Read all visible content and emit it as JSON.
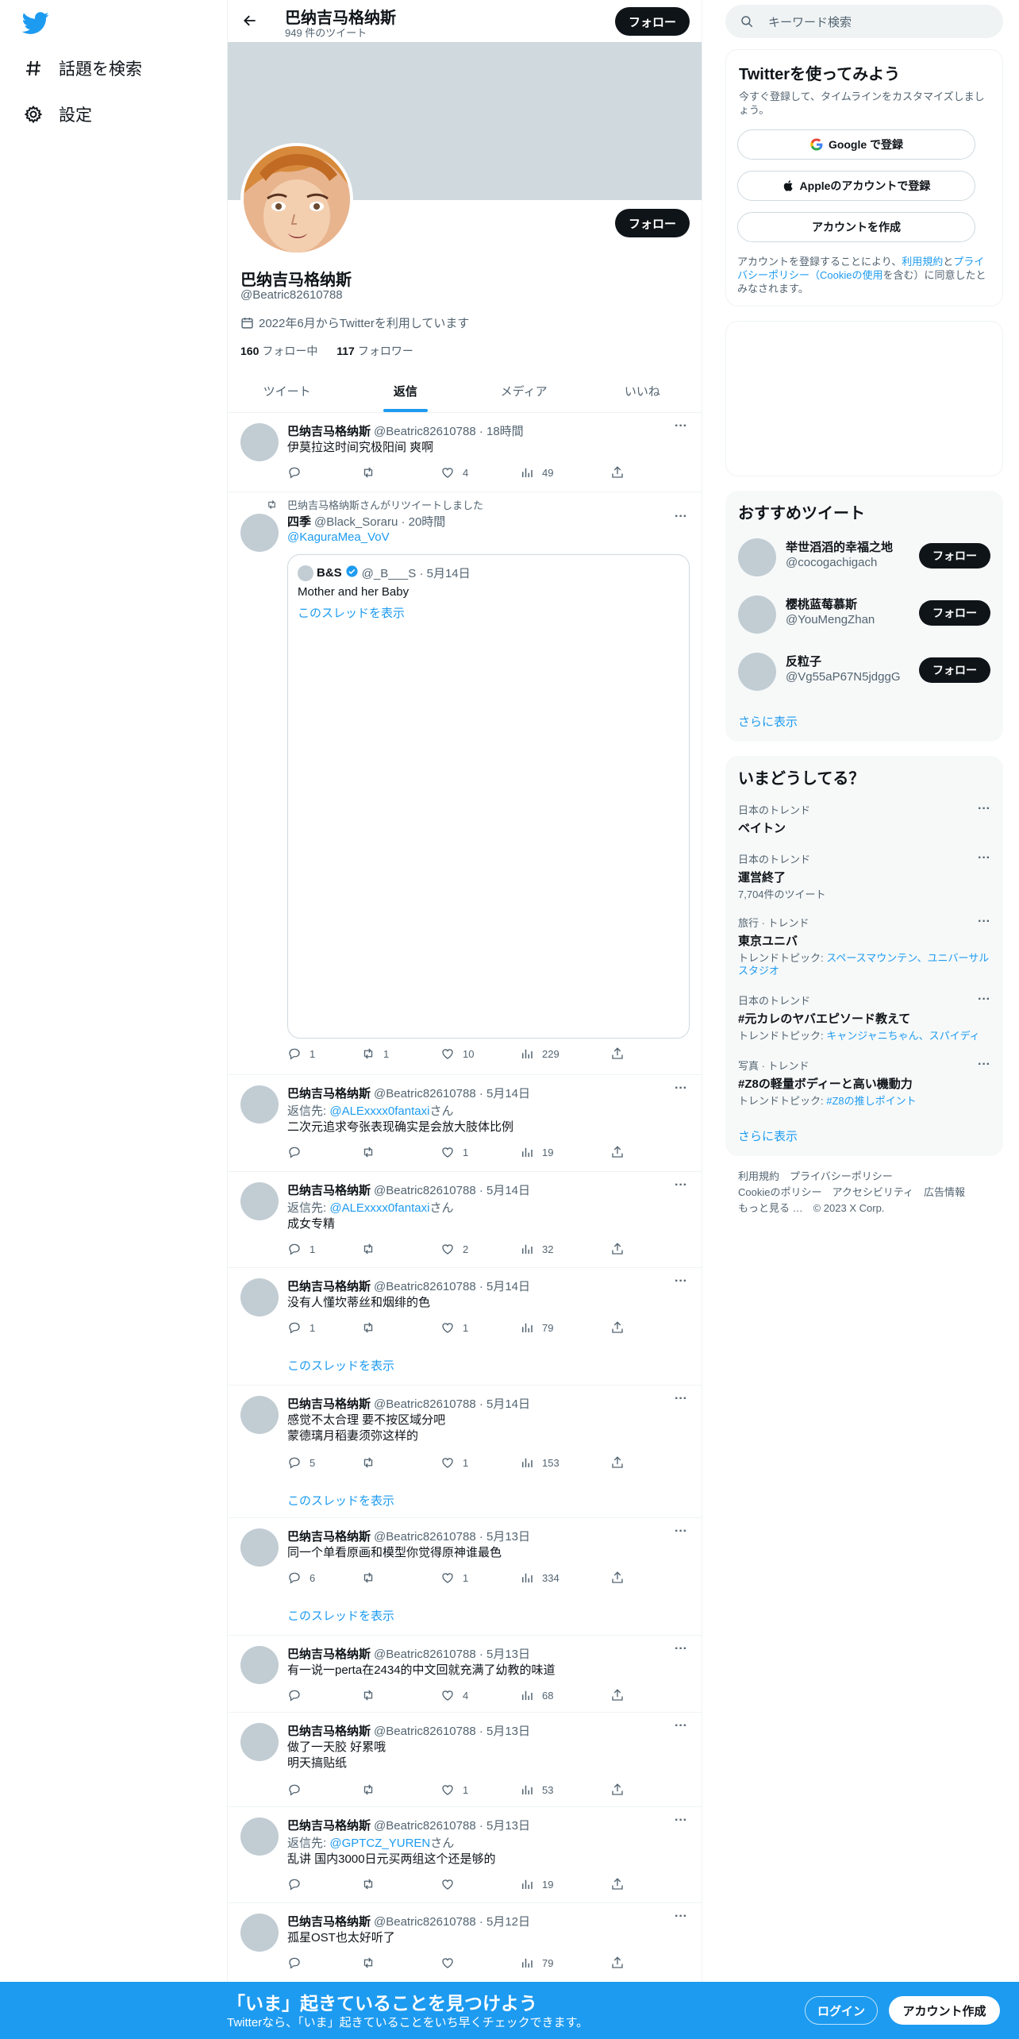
{
  "nav": {
    "search_label": "話題を検索",
    "settings_label": "設定"
  },
  "profile": {
    "name": "巴纳吉马格纳斯",
    "tweet_count": "949 件のツイート",
    "follow_label": "フォロー",
    "handle": "@Beatric82610788",
    "joined": "2022年6月からTwitterを利用しています",
    "following_count": "160",
    "following_label": "フォロー中",
    "followers_count": "117",
    "followers_label": "フォロワー"
  },
  "tabs": [
    "ツイート",
    "返信",
    "メディア",
    "いいね"
  ],
  "tweets": [
    {
      "name": "巴纳吉马格纳斯",
      "meta": "@Beatric82610788 · 18時間",
      "text": "伊莫拉这时间究极阳间 爽啊",
      "replies": "",
      "retweets": "",
      "likes": "4",
      "views": "49"
    },
    {
      "retweet_note": "巴纳吉马格纳斯さんがリツイートしました",
      "name": "四季",
      "meta": "@Black_Soraru · 20時間",
      "mention": "@KaguraMea_VoV",
      "quote": {
        "name": "B&S",
        "meta": "@_B___S · 5月14日",
        "text": "Mother and her Baby",
        "thread": "このスレッドを表示"
      },
      "replies": "1",
      "retweets": "1",
      "likes": "10",
      "views": "229"
    },
    {
      "name": "巴纳吉马格纳斯",
      "meta": "@Beatric82610788 · 5月14日",
      "reply_prefix": "返信先: ",
      "reply_to": "@ALExxxx0fantaxi",
      "reply_suffix": "さん",
      "text": "二次元追求夸张表现确实是会放大肢体比例",
      "replies": "",
      "retweets": "",
      "likes": "1",
      "views": "19"
    },
    {
      "name": "巴纳吉马格纳斯",
      "meta": "@Beatric82610788 · 5月14日",
      "reply_prefix": "返信先: ",
      "reply_to": "@ALExxxx0fantaxi",
      "reply_suffix": "さん",
      "text": "成女专精",
      "replies": "1",
      "retweets": "",
      "likes": "2",
      "views": "32"
    },
    {
      "name": "巴纳吉马格纳斯",
      "meta": "@Beatric82610788 · 5月14日",
      "text": "没有人懂坎蒂丝和烟绯的色",
      "replies": "1",
      "retweets": "",
      "likes": "1",
      "views": "79",
      "thread": "このスレッドを表示"
    },
    {
      "name": "巴纳吉马格纳斯",
      "meta": "@Beatric82610788 · 5月14日",
      "text": "感觉不太合理 要不按区域分吧\n蒙德璃月稻妻须弥这样的",
      "replies": "5",
      "retweets": "",
      "likes": "1",
      "views": "153",
      "thread": "このスレッドを表示"
    },
    {
      "name": "巴纳吉马格纳斯",
      "meta": "@Beatric82610788 · 5月13日",
      "text": "同一个单看原画和模型你觉得原神谁最色",
      "replies": "6",
      "retweets": "",
      "likes": "1",
      "views": "334",
      "thread": "このスレッドを表示"
    },
    {
      "name": "巴纳吉马格纳斯",
      "meta": "@Beatric82610788 · 5月13日",
      "text": "有一说一perta在2434的中文回就充满了幼教的味道",
      "replies": "",
      "retweets": "",
      "likes": "4",
      "views": "68"
    },
    {
      "name": "巴纳吉马格纳斯",
      "meta": "@Beatric82610788 · 5月13日",
      "text": "做了一天胶 好累哦\n明天搞贴纸",
      "replies": "",
      "retweets": "",
      "likes": "1",
      "views": "53"
    },
    {
      "name": "巴纳吉马格纳斯",
      "meta": "@Beatric82610788 · 5月13日",
      "reply_prefix": "返信先: ",
      "reply_to": "@GPTCZ_YUREN",
      "reply_suffix": "さん",
      "text": "乱讲 国内3000日元买两组这个还是够的",
      "replies": "",
      "retweets": "",
      "likes": "",
      "views": "19"
    },
    {
      "name": "巴纳吉马格纳斯",
      "meta": "@Beatric82610788 · 5月12日",
      "text": "孤星OST也太好听了",
      "replies": "",
      "retweets": "",
      "likes": "",
      "views": "79"
    }
  ],
  "sidebar": {
    "search_placeholder": "キーワード検索",
    "signup": {
      "title": "Twitterを使ってみよう",
      "subtitle": "今すぐ登録して、タイムラインをカスタマイズしましょう。",
      "google": "Google で登録",
      "apple": "Appleのアカウントで登録",
      "create": "アカウントを作成",
      "legal_1": "アカウントを登録することにより、",
      "legal_terms": "利用規約",
      "legal_2": "と",
      "legal_privacy": "プライバシーポリシー（Cookieの使用",
      "legal_3": "を含む）に同意したとみなされます。"
    },
    "recommended": {
      "title": "おすすめツイート",
      "follow_label": "フォロー",
      "users": [
        {
          "name": "举世滔滔的幸福之地",
          "handle": "@cocogachigach"
        },
        {
          "name": "樱桃蓝莓慕斯",
          "handle": "@YouMengZhan"
        },
        {
          "name": "反粒子",
          "handle": "@Vg55aP67N5jdggG"
        }
      ],
      "more": "さらに表示"
    },
    "trends": {
      "title": "いまどうしてる？",
      "items": [
        {
          "category": "日本のトレンド",
          "name": "ベイトン",
          "sub_label": "",
          "sub_links": "",
          "count": ""
        },
        {
          "category": "日本のトレンド",
          "name": "運営終了",
          "sub_label": "",
          "sub_links": "",
          "count": "7,704件のツイート"
        },
        {
          "category": "旅行 · トレンド",
          "name": "東京ユニバ",
          "sub_label": "トレンドトピック: ",
          "sub_links": "スペースマウンテン、ユニバーサルスタジオ",
          "count": ""
        },
        {
          "category": "日本のトレンド",
          "name": "#元カレのヤバエピソード教えて",
          "sub_label": "トレンドトピック: ",
          "sub_links": "キャンジャニちゃん、スパイディ",
          "count": ""
        },
        {
          "category": "写真 · トレンド",
          "name": "#Z8の軽量ボディーと高い機動力",
          "sub_label": "トレンドトピック: ",
          "sub_links": "#Z8の推しポイント",
          "count": ""
        }
      ],
      "more": "さらに表示"
    },
    "footer": {
      "line1": "利用規約　プライバシーポリシー",
      "line2": "Cookieのポリシー　アクセシビリティ　広告情報",
      "line3": "もっと見る …　© 2023 X Corp."
    }
  },
  "bottom_bar": {
    "title": "「いま」起きていることを見つけよう",
    "subtitle": "Twitterなら、「いま」起きていることをいち早くチェックできます。",
    "login": "ログイン",
    "signup": "アカウント作成"
  },
  "colors": {
    "accent": "#1d9bf0",
    "text": "#0f1419",
    "muted": "#536471",
    "banner": "#cfd9de"
  }
}
